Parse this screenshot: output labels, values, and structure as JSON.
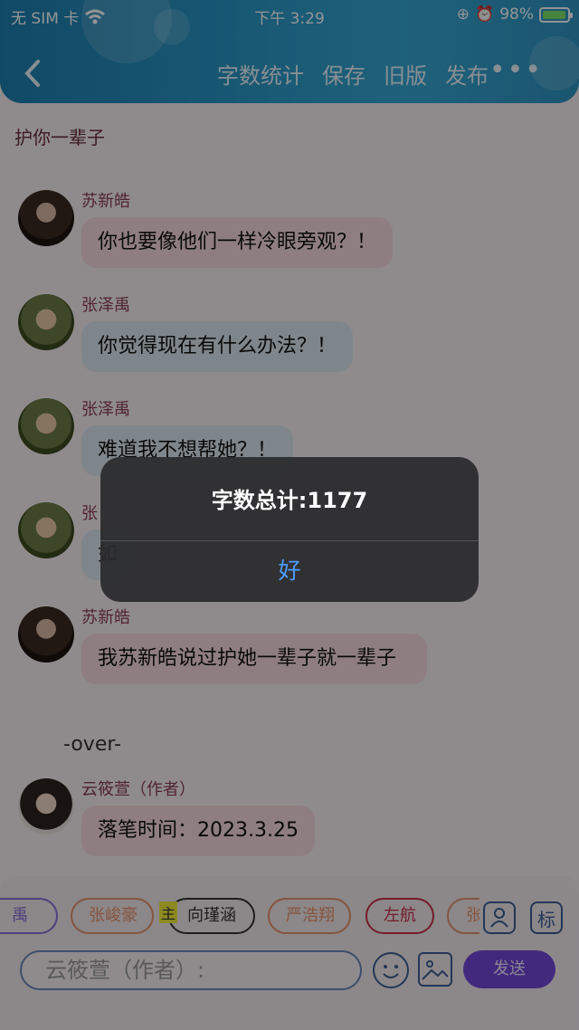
{
  "status_bar": {
    "carrier": "无 SIM 卡",
    "time": "下午 3:29",
    "battery": "98%",
    "battery_level": 0.98
  },
  "nav": {
    "actions": [
      "字数统计",
      "保存",
      "旧版",
      "发布"
    ],
    "more_icon": "ellipsis-icon"
  },
  "chat": {
    "title": "护你一辈子",
    "messages": [
      {
        "name": "苏新皓",
        "text": "你也要像他们一样冷眼旁观？！",
        "bubble": "pink"
      },
      {
        "name": "张泽禹",
        "text": "你觉得现在有什么办法？！",
        "bubble": "blue"
      },
      {
        "name": "张泽禹",
        "text": "难道我不想帮她？！",
        "bubble": "blue"
      },
      {
        "name": "张",
        "text": "如",
        "bubble": "blue"
      },
      {
        "name": "苏新皓",
        "text": "我苏新皓说过护她一辈子就一辈子",
        "bubble": "pink"
      }
    ],
    "over_text": "-over-",
    "author_message": {
      "name": "云筱萱（作者）",
      "text": "落笔时间：2023.3.25"
    }
  },
  "bottom": {
    "chips": [
      "禹",
      "张峻豪",
      "向瑾涵",
      "严浩翔",
      "左航",
      "张"
    ],
    "main_tag": "主",
    "tag_button": "标",
    "input_placeholder": "云筱萱（作者）:",
    "send_label": "发送"
  },
  "alert": {
    "title": "字数总计:1177",
    "button": "好"
  },
  "colors": {
    "accent_blue": "#4d9dff",
    "send_purple": "#7448d8",
    "pink_bubble": "#f7d9df",
    "blue_bubble": "#dbe7f0"
  }
}
